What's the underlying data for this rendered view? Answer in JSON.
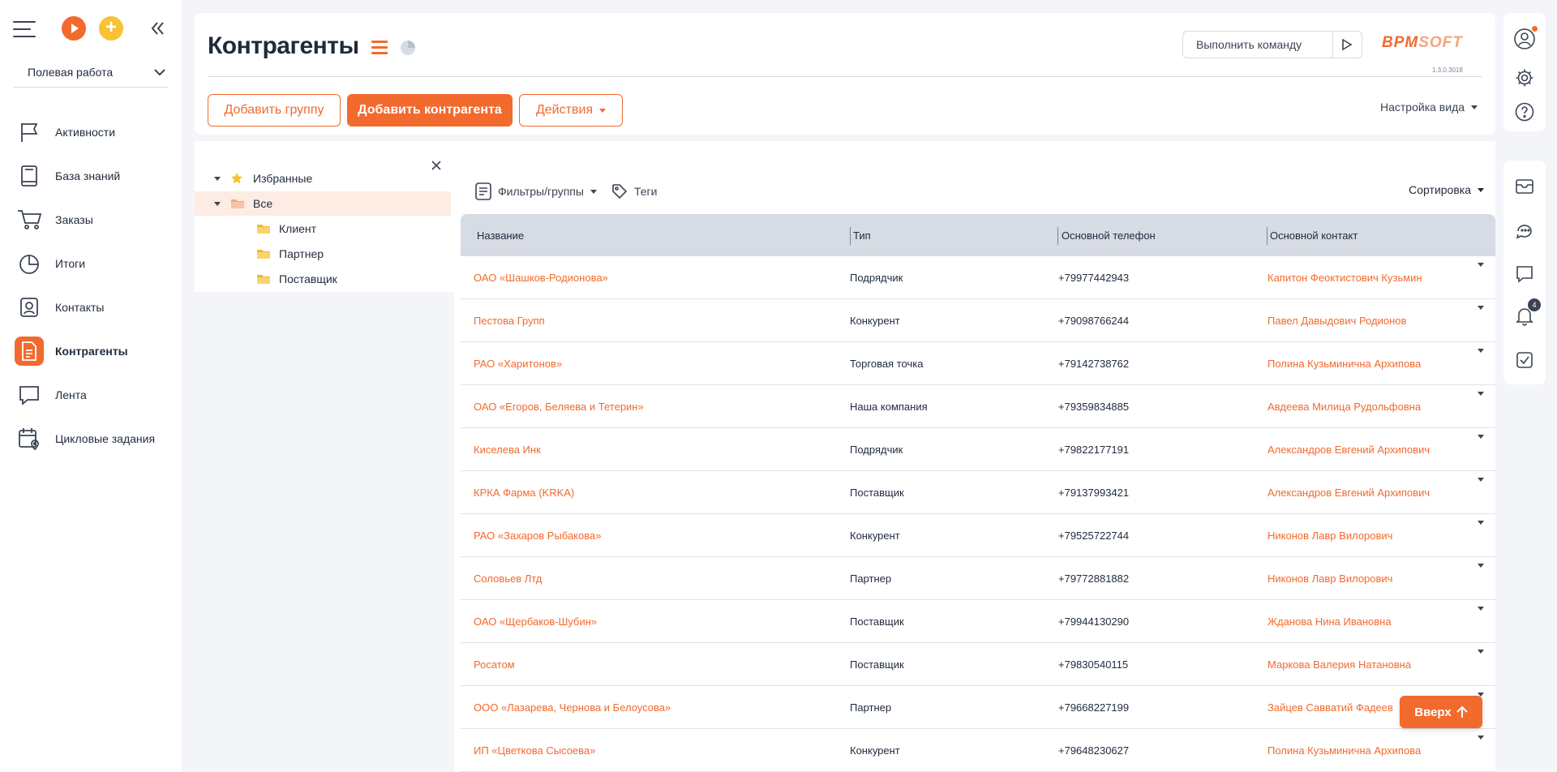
{
  "sidebar": {
    "workspace": "Полевая работа",
    "items": [
      {
        "label": "Активности",
        "icon": "flag-icon"
      },
      {
        "label": "База знаний",
        "icon": "book-icon"
      },
      {
        "label": "Заказы",
        "icon": "cart-icon"
      },
      {
        "label": "Итоги",
        "icon": "pie-chart-icon"
      },
      {
        "label": "Контакты",
        "icon": "contact-icon"
      },
      {
        "label": "Контрагенты",
        "icon": "document-icon",
        "active": true
      },
      {
        "label": "Лента",
        "icon": "chat-icon"
      },
      {
        "label": "Цикловые задания",
        "icon": "calendar-location-icon"
      }
    ]
  },
  "header": {
    "title": "Контрагенты",
    "command_placeholder": "Выполнить команду",
    "logo_main": "BPM",
    "logo_light": "SOFT",
    "version": "1.3.0.3018",
    "add_group": "Добавить группу",
    "add_account": "Добавить контрагента",
    "actions": "Действия",
    "view_settings": "Настройка вида"
  },
  "tree": {
    "favorites": "Избранные",
    "all": "Все",
    "folders": [
      "Клиент",
      "Партнер",
      "Поставщик"
    ]
  },
  "grid": {
    "filters": "Фильтры/группы",
    "tags": "Теги",
    "sort": "Сортировка",
    "columns": [
      "Название",
      "Тип",
      "Основной телефон",
      "Основной контакт"
    ],
    "rows": [
      [
        "ОАО «Шашков-Родионова»",
        "Подрядчик",
        "+79977442943",
        "Капитон Феоктистович Кузьмин"
      ],
      [
        "Пестова Групп",
        "Конкурент",
        "+79098766244",
        "Павел Давыдович Родионов"
      ],
      [
        "РАО «Харитонов»",
        "Торговая точка",
        "+79142738762",
        "Полина Кузьминична Архипова"
      ],
      [
        "ОАО «Егоров, Беляева и Тетерин»",
        "Наша компания",
        "+79359834885",
        "Авдеева Милица Рудольфовна"
      ],
      [
        "Киселева Инк",
        "Подрядчик",
        "+79822177191",
        "Александров Евгений Архипович"
      ],
      [
        "КРКА Фарма (KRKA)",
        "Поставщик",
        "+79137993421",
        "Александров Евгений Архипович"
      ],
      [
        "РАО «Захаров Рыбакова»",
        "Конкурент",
        "+79525722744",
        "Никонов Лавр Вилорович"
      ],
      [
        "Соловьев Лтд",
        "Партнер",
        "+79772881882",
        "Никонов Лавр Вилорович"
      ],
      [
        "ОАО «Щербаков-Шубин»",
        "Поставщик",
        "+79944130290",
        "Жданова Нина Ивановна"
      ],
      [
        "Росатом",
        "Поставщик",
        "+79830540115",
        "Маркова Валерия Натановна"
      ],
      [
        "ООО «Лазарева, Чернова и Белоусова»",
        "Партнер",
        "+79668227199",
        "Зайцев Савватий Фадеев"
      ],
      [
        "ИП «Цветкова Сысоева»",
        "Конкурент",
        "+79648230627",
        "Полина Кузьминична Архипова"
      ]
    ],
    "scroll_top": "Вверх"
  },
  "rail": {
    "notifications_count": "4"
  },
  "colors": {
    "accent": "#f26a2e",
    "accent_light": "#fdece4",
    "header_bg": "#d7dbe3",
    "text": "#1f2a3c"
  }
}
